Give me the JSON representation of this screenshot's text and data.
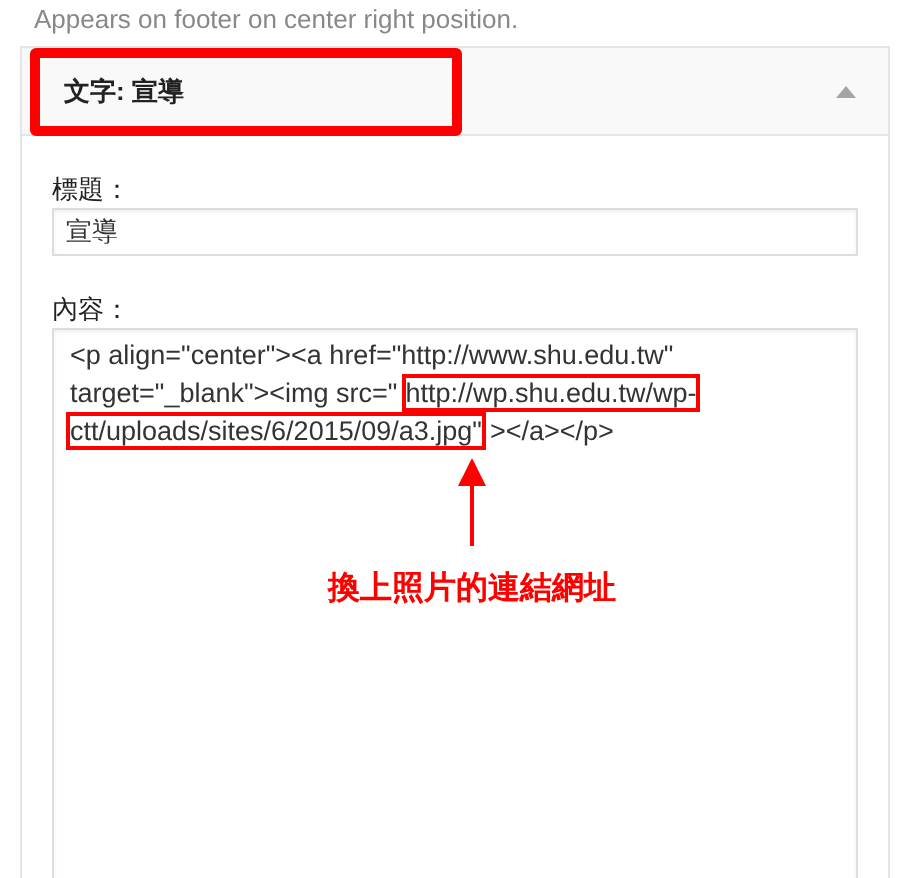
{
  "description": "Appears on footer on center right position.",
  "widget": {
    "title": "文字: 宣導",
    "expanded": true,
    "title_highlighted": true,
    "fields": [
      {
        "kind": "input",
        "label": "標題：",
        "value": "宣導"
      },
      {
        "kind": "textarea",
        "label": "內容：",
        "lines": [
          [
            {
              "text": "<p align=\"center\"><a href=\"http://www.shu.edu.tw\"",
              "highlighted": false
            }
          ],
          [
            {
              "text": "target=\"_blank\"><img src=\"",
              "highlighted": false
            },
            {
              "text": "http://wp.shu.edu.tw/wp-",
              "highlighted": true
            }
          ],
          [
            {
              "text": "ctt/uploads/sites/6/2015/09/a3.jpg\"",
              "highlighted": true
            },
            {
              "text": "></a></p>",
              "highlighted": false
            }
          ]
        ]
      }
    ]
  },
  "annotation": {
    "text": "換上照片的連結網址"
  }
}
